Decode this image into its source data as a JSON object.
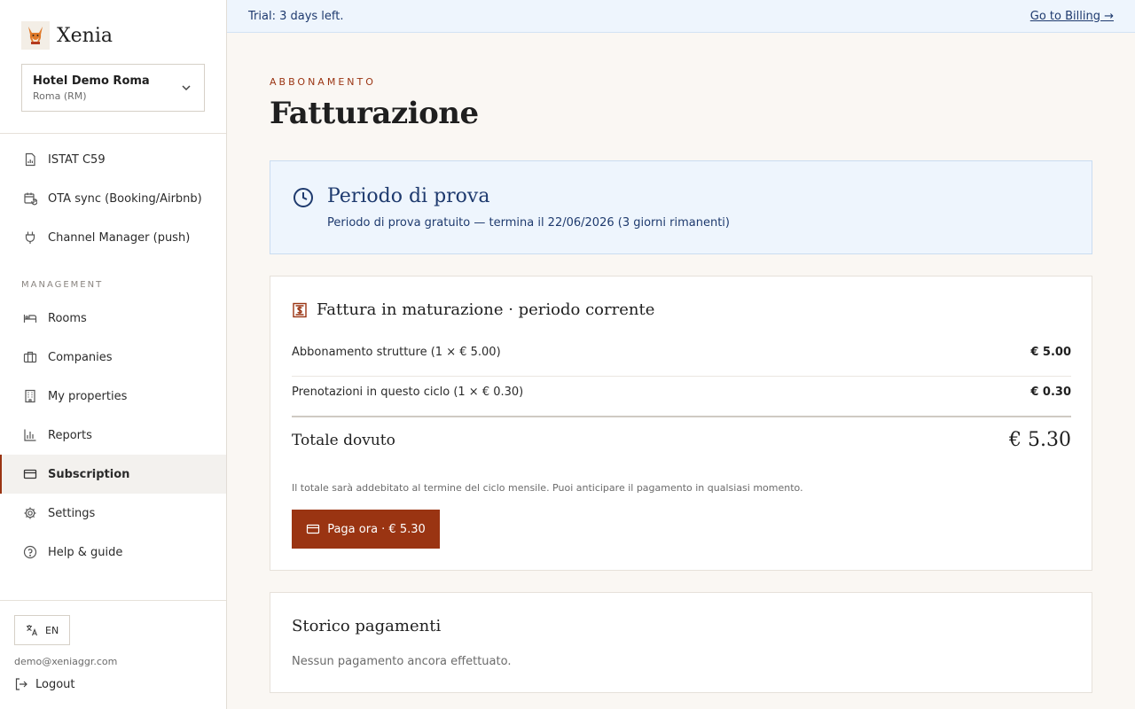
{
  "app": {
    "name": "Xenia"
  },
  "property": {
    "name": "Hotel Demo Roma",
    "location": "Roma (RM)"
  },
  "sidebar": {
    "items_top": [
      {
        "label": "ISTAT C59",
        "icon": "file-chart-icon"
      },
      {
        "label": "OTA sync (Booking/Airbnb)",
        "icon": "calendar-sync-icon"
      },
      {
        "label": "Channel Manager (push)",
        "icon": "plug-icon"
      }
    ],
    "section_label": "MANAGEMENT",
    "items_management": [
      {
        "label": "Rooms",
        "icon": "bed-icon"
      },
      {
        "label": "Companies",
        "icon": "briefcase-icon"
      },
      {
        "label": "My properties",
        "icon": "building-icon"
      },
      {
        "label": "Reports",
        "icon": "bar-chart-icon"
      },
      {
        "label": "Subscription",
        "icon": "credit-card-icon",
        "active": true
      },
      {
        "label": "Settings",
        "icon": "gear-icon"
      },
      {
        "label": "Help & guide",
        "icon": "help-circle-icon"
      }
    ],
    "language": "EN",
    "user_email": "demo@xeniaggr.com",
    "logout_label": "Logout"
  },
  "trial_banner": {
    "text": "Trial: 3 days left.",
    "link": "Go to Billing →"
  },
  "page": {
    "eyebrow": "ABBONAMENTO",
    "title": "Fatturazione"
  },
  "trial_card": {
    "title": "Periodo di prova",
    "text": "Periodo di prova gratuito — termina il 22/06/2026 (3 giorni rimanenti)"
  },
  "invoice": {
    "title": "Fattura in maturazione · periodo corrente",
    "lines": [
      {
        "label": "Abbonamento strutture (1 × € 5.00)",
        "amount": "€ 5.00"
      },
      {
        "label": "Prenotazioni in questo ciclo (1 × € 0.30)",
        "amount": "€ 0.30"
      }
    ],
    "total_label": "Totale dovuto",
    "total_amount": "€ 5.30",
    "note": "Il totale sarà addebitato al termine del ciclo mensile. Puoi anticipare il pagamento in qualsiasi momento.",
    "pay_label": "Paga ora · € 5.30"
  },
  "history": {
    "title": "Storico pagamenti",
    "empty_text": "Nessun pagamento ancora effettuato."
  },
  "colors": {
    "accent": "#9a3412",
    "info_blue": "#1e3a6e",
    "info_bg": "#eef5fd"
  }
}
